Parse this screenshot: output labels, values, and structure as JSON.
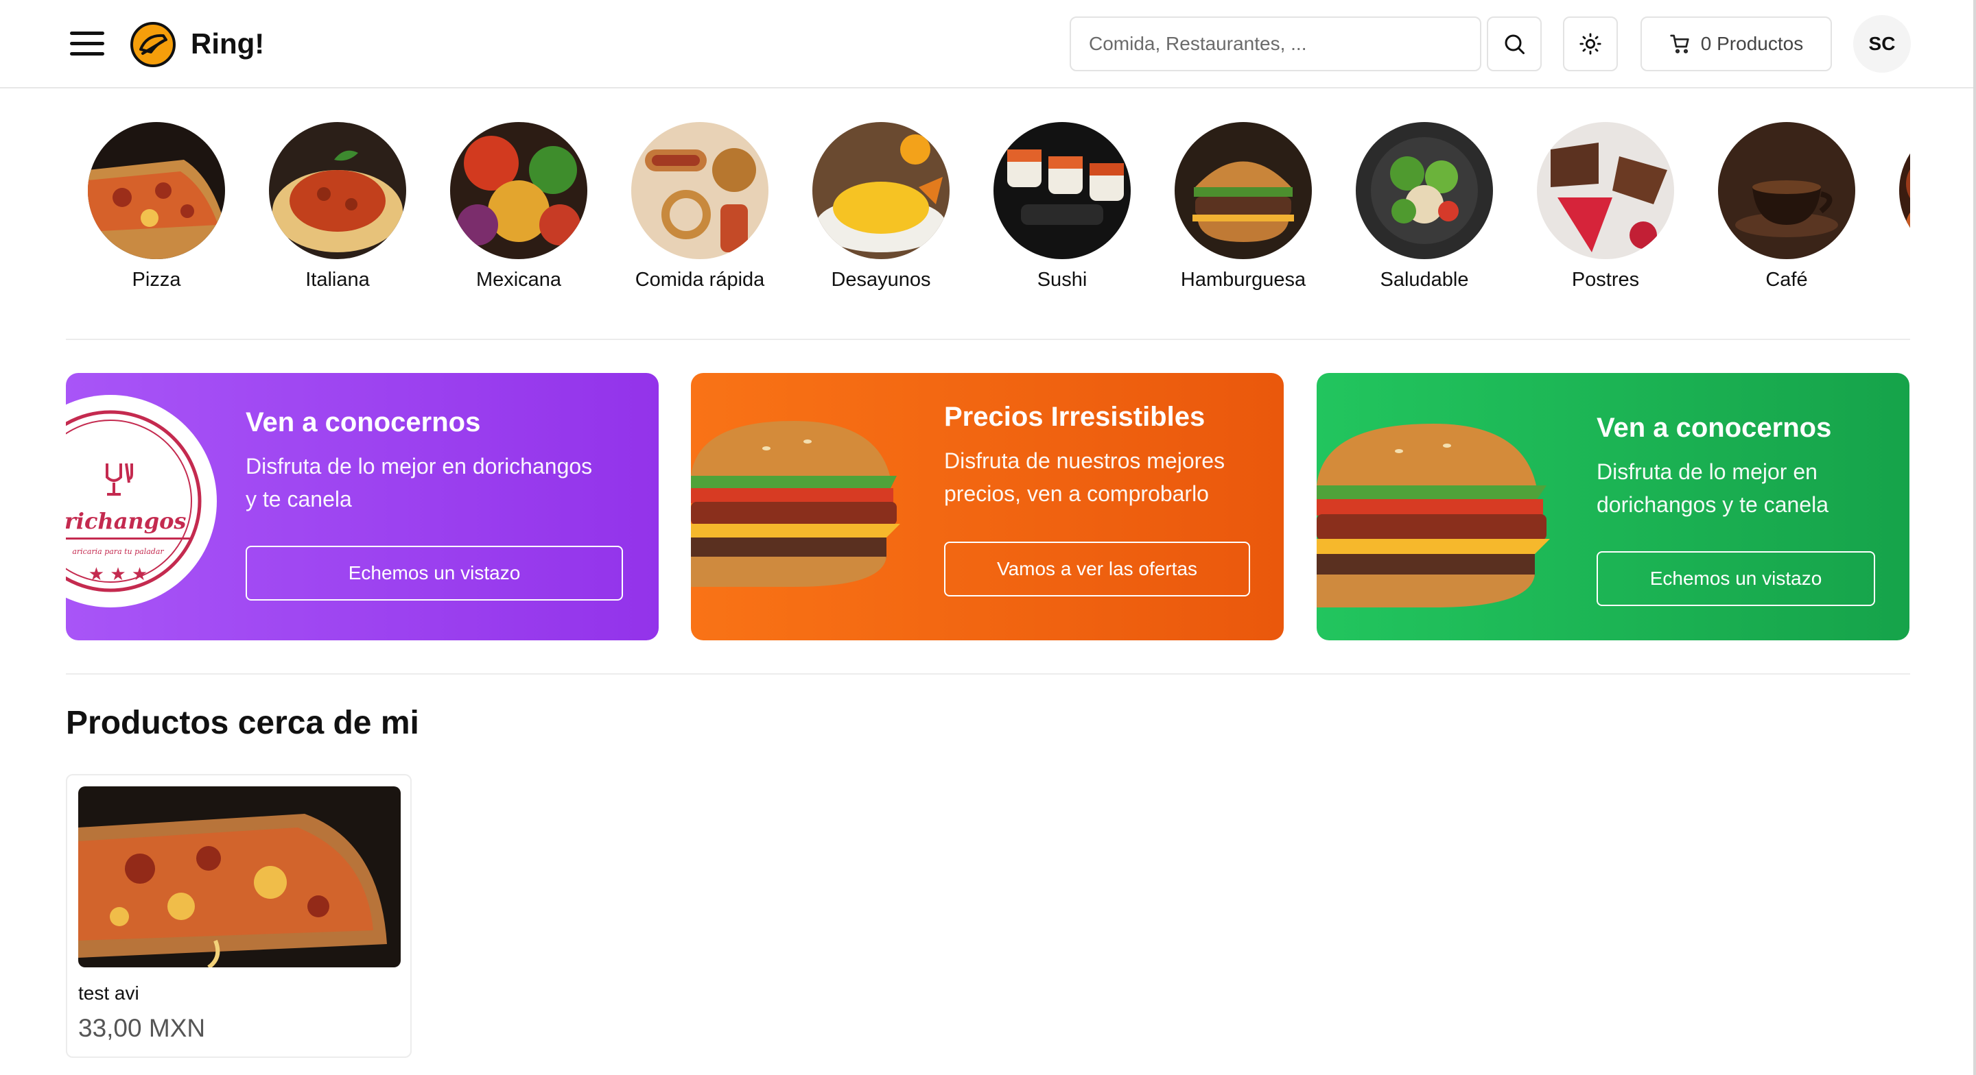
{
  "header": {
    "brand": "Ring!",
    "search_placeholder": "Comida, Restaurantes, ...",
    "cart_label": "0 Productos",
    "avatar_initials": "SC"
  },
  "categories": [
    {
      "label": "Pizza"
    },
    {
      "label": "Italiana"
    },
    {
      "label": "Mexicana"
    },
    {
      "label": "Comida rápida"
    },
    {
      "label": "Desayunos"
    },
    {
      "label": "Sushi"
    },
    {
      "label": "Hamburguesa"
    },
    {
      "label": "Saludable"
    },
    {
      "label": "Postres"
    },
    {
      "label": "Café"
    }
  ],
  "banners": [
    {
      "title": "Ven a conocernos",
      "text_lines": [
        "Disfruta de lo mejor en dorichangos",
        "y te canela"
      ],
      "button": "Echemos un vistazo",
      "logo_text": "orichangos",
      "logo_subtext": "aricaria para tu paladar"
    },
    {
      "title": "Precios Irresistibles",
      "text_lines": [
        "Disfruta de nuestros mejores",
        "precios, ven a comprobarlo"
      ],
      "button": "Vamos a ver las ofertas"
    },
    {
      "title": "Ven a conocernos",
      "text_lines": [
        "Disfruta de lo mejor en",
        "dorichangos y te canela"
      ],
      "button": "Echemos un vistazo"
    }
  ],
  "products_section": {
    "title": "Productos cerca de mi",
    "items": [
      {
        "name": "test avi",
        "price": "33,00 MXN"
      }
    ]
  },
  "colors": {
    "purple": "#9333ea",
    "orange": "#ea580c",
    "green": "#16a34a",
    "logo_orange": "#f59e0b"
  }
}
